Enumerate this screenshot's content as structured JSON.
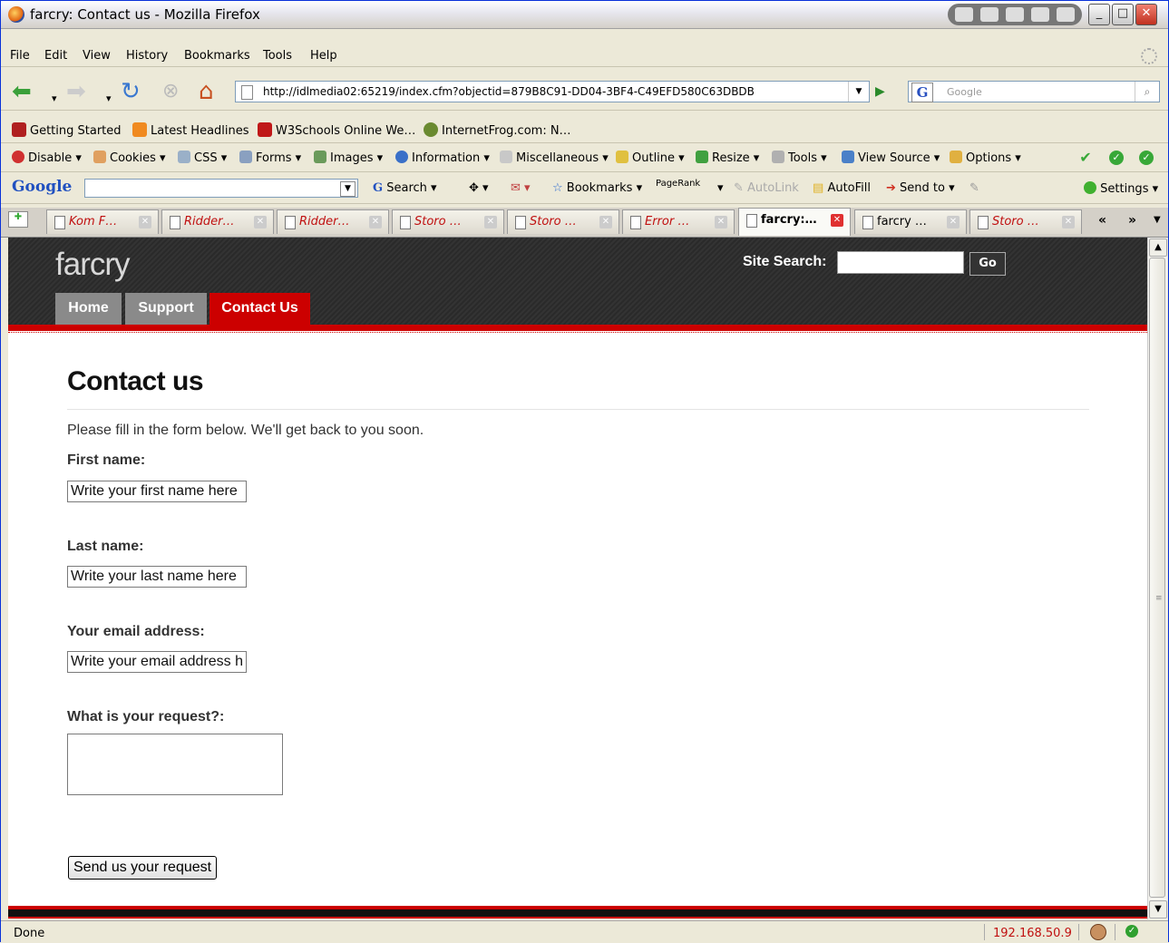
{
  "window": {
    "title": "farcry: Contact us - Mozilla Firefox",
    "minimize_label": "_",
    "maximize_label": "□",
    "close_label": "✕"
  },
  "menu": {
    "items": [
      "File",
      "Edit",
      "View",
      "History",
      "Bookmarks",
      "Tools",
      "Help"
    ]
  },
  "nav": {
    "url": "http://idlmedia02:65219/index.cfm?objectid=879B8C91-DD04-3BF4-C49EFD580C63DBDB",
    "search_placeholder": "Google"
  },
  "bookmarks": {
    "items": [
      "Getting Started",
      "Latest Headlines",
      "W3Schools Online We…",
      "InternetFrog.com: N…"
    ]
  },
  "webdev": {
    "items": [
      "Disable",
      "Cookies",
      "CSS",
      "Forms",
      "Images",
      "Information",
      "Miscellaneous",
      "Outline",
      "Resize",
      "Tools",
      "View Source",
      "Options"
    ]
  },
  "googlebar": {
    "logo": "Google",
    "search_label": "Search",
    "bookmarks_label": "Bookmarks",
    "pagerank_label": "PageRank",
    "autolink_label": "AutoLink",
    "autofill_label": "AutoFill",
    "sendto_label": "Send to",
    "settings_label": "Settings"
  },
  "tabs": [
    {
      "label": "Kom F…",
      "style": "red"
    },
    {
      "label": "Ridder…",
      "style": "red"
    },
    {
      "label": "Ridder…",
      "style": "red"
    },
    {
      "label": "Storo …",
      "style": "red"
    },
    {
      "label": "Storo …",
      "style": "red"
    },
    {
      "label": "Error …",
      "style": "red"
    },
    {
      "label": "farcry:…",
      "style": "active"
    },
    {
      "label": "farcry …",
      "style": "normal"
    },
    {
      "label": "Storo …",
      "style": "red"
    }
  ],
  "site": {
    "logo": "farcry",
    "site_search_label": "Site Search:",
    "go_label": "Go",
    "nav": [
      {
        "label": "Home"
      },
      {
        "label": "Support"
      },
      {
        "label": "Contact Us"
      }
    ],
    "colors": {
      "accent": "#cc0000",
      "nav_inactive": "#8a8a8a",
      "header_bg": "#2b2b2b"
    }
  },
  "page": {
    "title": "Contact us",
    "intro": "Please fill in the form below. We'll get back to you soon.",
    "first_name_label": "First name:",
    "first_name_value": "Write your first name here",
    "last_name_label": "Last name:",
    "last_name_value": "Write your last name here",
    "email_label": "Your email address:",
    "email_value": "Write your email address h",
    "request_label": "What is your request?:",
    "request_value": "",
    "submit_label": "Send us your request"
  },
  "status": {
    "text": "Done",
    "ip": "192.168.50.9"
  }
}
